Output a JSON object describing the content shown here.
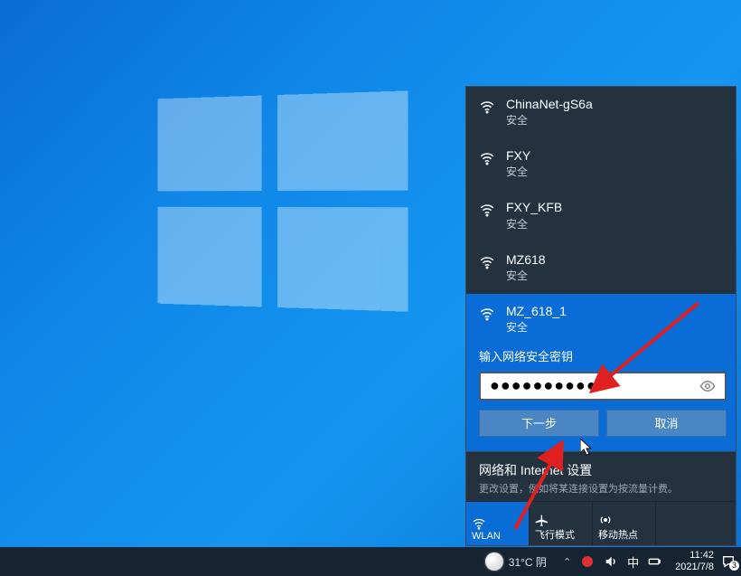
{
  "networks": [
    {
      "name": "ChinaNet-gS6a",
      "status": "安全"
    },
    {
      "name": "FXY",
      "status": "安全"
    },
    {
      "name": "FXY_KFB",
      "status": "安全"
    },
    {
      "name": "MZ618",
      "status": "安全"
    }
  ],
  "selected_network": {
    "name": "MZ_618_1",
    "status": "安全",
    "password_label": "输入网络安全密钥",
    "password_value": "●●●●●●●●●●●",
    "ime_badge": "中",
    "next_button": "下一步",
    "cancel_button": "取消"
  },
  "settings": {
    "title": "网络和 Internet 设置",
    "subtitle": "更改设置，例如将某连接设置为按流量计费。"
  },
  "tiles": {
    "wlan": "WLAN",
    "airplane": "飞行模式",
    "hotspot": "移动热点"
  },
  "taskbar": {
    "weather_text": "31°C 阴",
    "chevron": "⌃",
    "ime": "中",
    "time": "11:42",
    "date": "2021/7/8",
    "notif_count": "3"
  }
}
